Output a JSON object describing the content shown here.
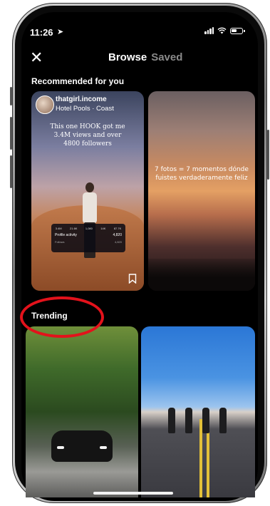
{
  "status": {
    "time": "11:26"
  },
  "header": {
    "browse_label": "Browse",
    "saved_label": "Saved"
  },
  "recommended": {
    "title": "Recommended for you",
    "card1": {
      "account": "thatgirl.income",
      "subtitle": "Hotel Pools · Coast",
      "overlay": "This one HOOK got me 3.4M views and over 4800 followers",
      "stats": [
        "3.4M",
        "21.6K",
        "1,080",
        "14K",
        "87.7K"
      ],
      "profile_activity": "Profile activity",
      "profile_value": "4,820",
      "followers": "Follows",
      "followers_value": "4,820"
    },
    "card2": {
      "overlay": "7 fotos = 7 momentos dónde fuistes verdaderamente feliz"
    }
  },
  "trending": {
    "title": "Trending"
  },
  "colors": {
    "accent_red": "#e3121b",
    "background": "#000000"
  }
}
